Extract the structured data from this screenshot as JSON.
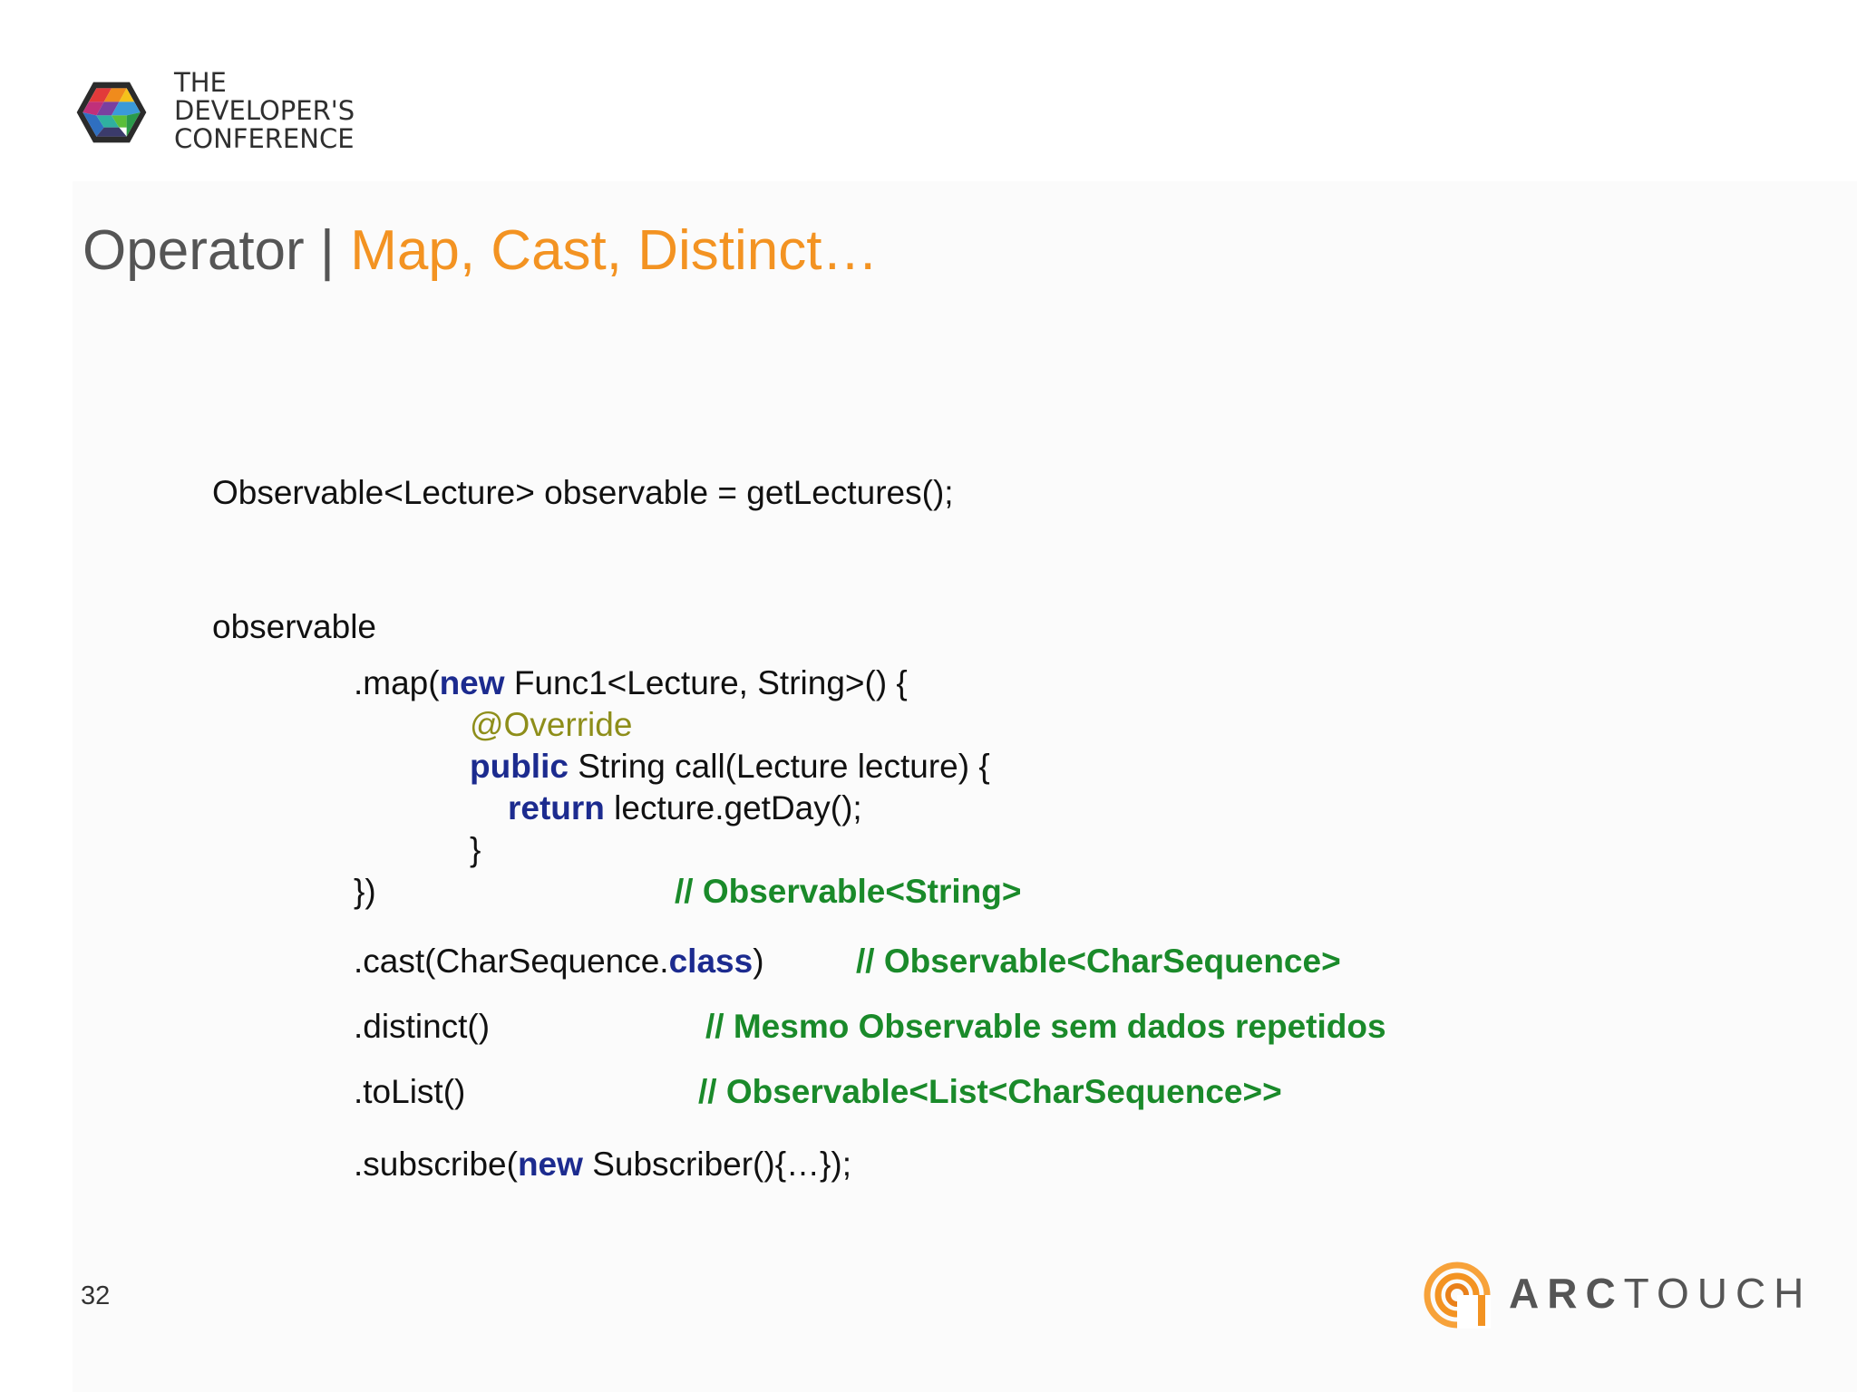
{
  "logo": {
    "lines": [
      "THE",
      "DEVELOPER'S",
      "CONFERENCE"
    ]
  },
  "title": {
    "prefix": "Operator | ",
    "highlight": "Map, Cast, Distinct…"
  },
  "code": {
    "line1": "Observable<Lecture> observable = getLectures();",
    "line2": "observable",
    "map_open": ".map(",
    "map_new": "new",
    "map_rest": " Func1<Lecture, String>() {",
    "override": "@Override",
    "call_public": "public",
    "call_rest": " String call(Lecture lecture) {",
    "ret_kw": "return",
    "ret_rest": " lecture.getDay();",
    "close_brace": "}",
    "close_map": "})",
    "comment_map": "// Observable<String>",
    "cast_text": ".cast(CharSequence.",
    "cast_kw": "class",
    "cast_end": ")",
    "comment_cast": "// Observable<CharSequence>",
    "distinct_text": ".distinct()",
    "comment_distinct": "// Mesmo Observable sem dados repetidos",
    "tolist_text": ".toList()",
    "comment_tolist": "// Observable<List<CharSequence>>",
    "subscribe_open": ".subscribe(",
    "subscribe_new": "new",
    "subscribe_rest": " Subscriber(){…});"
  },
  "footer": {
    "page_number": "32",
    "brand_bold": "ARC",
    "brand_light": "TOUCH"
  },
  "colors": {
    "title_orange": "#f39322",
    "keyword_blue": "#1c2b8f",
    "comment_green": "#1a8a2a",
    "annotation_olive": "#8e8e1a"
  }
}
